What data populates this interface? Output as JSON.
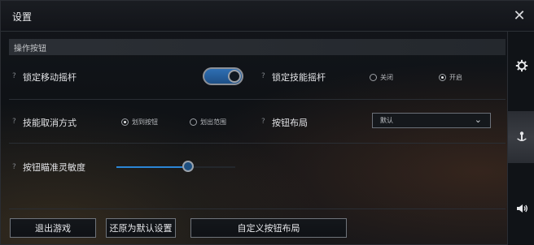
{
  "window": {
    "title": "设置",
    "close_icon": "close-icon"
  },
  "section": {
    "title": "操作按钮"
  },
  "settings": {
    "lock_joystick": {
      "label": "锁定移动摇杆",
      "help": "?",
      "enabled": true
    },
    "lock_skill_joystick": {
      "label": "锁定技能摇杆",
      "help": "?",
      "options": [
        {
          "label": "关闭",
          "selected": false
        },
        {
          "label": "开启",
          "selected": true
        }
      ]
    },
    "skill_cancel": {
      "label": "技能取消方式",
      "help": "?",
      "options": [
        {
          "label": "划到按钮",
          "selected": true
        },
        {
          "label": "划出范围",
          "selected": false
        }
      ]
    },
    "button_layout": {
      "label": "按钮布局",
      "help": "?",
      "value": "默认",
      "icon": "chevron-down-icon"
    },
    "aim_sensitivity": {
      "label": "按钮瞄准灵敏度",
      "help": "?",
      "value": 0.6
    }
  },
  "footer": {
    "exit_label": "退出游戏",
    "restore_label": "还原为默认设置",
    "custom_layout_label": "自定义按钮布局"
  },
  "rail": {
    "items": [
      {
        "icon": "gear-icon",
        "active": false
      },
      {
        "icon": "anchor-icon",
        "active": true
      },
      {
        "icon": "speaker-icon",
        "active": false
      }
    ]
  },
  "colors": {
    "accent": "#2b86d6",
    "toggle_on": "#2e6fb3"
  }
}
